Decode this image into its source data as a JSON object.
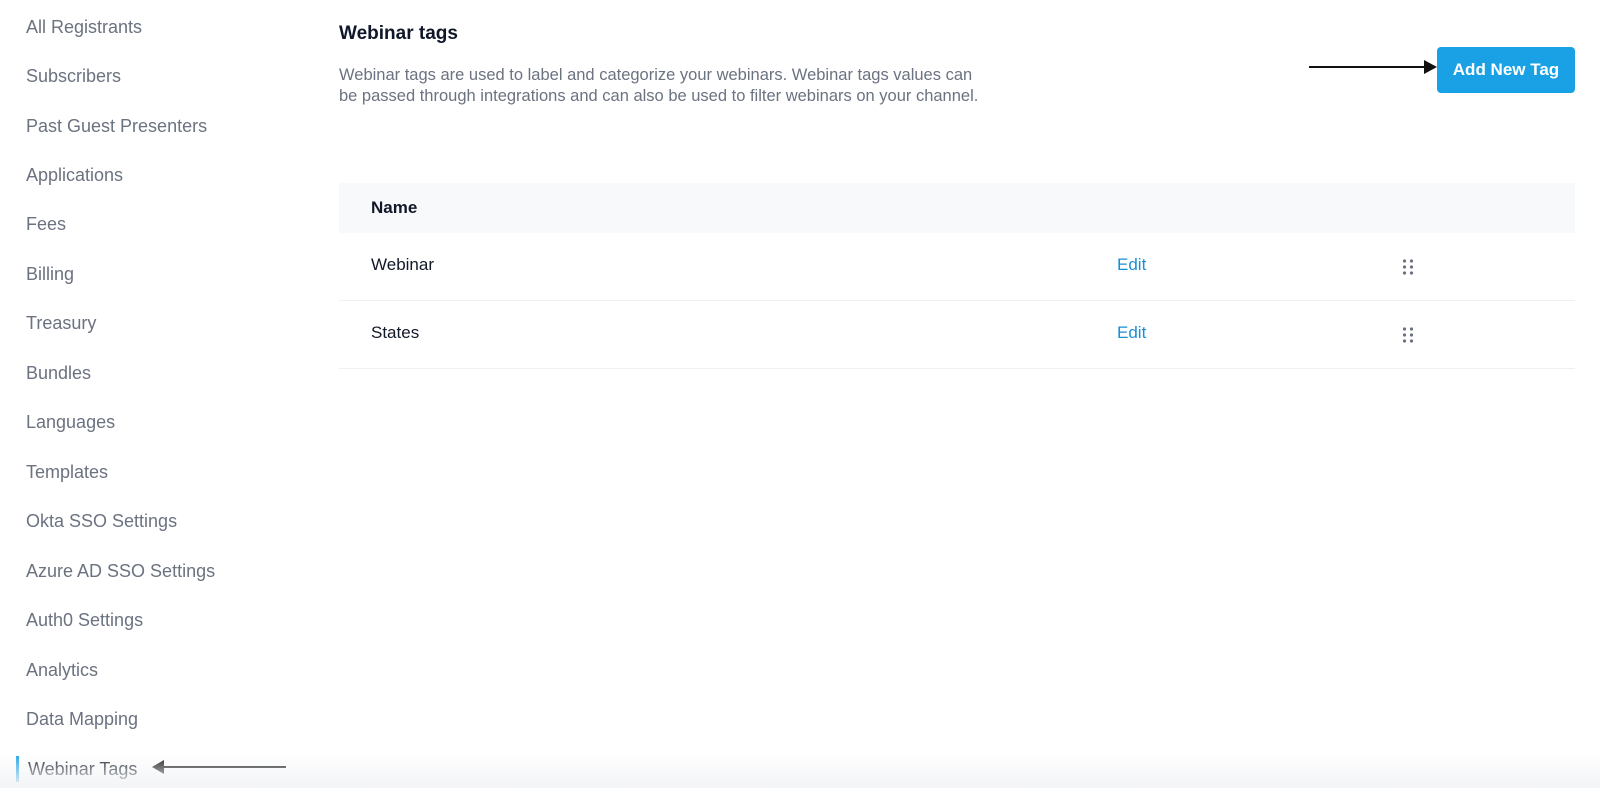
{
  "sidebar": {
    "items": [
      {
        "label": "All Registrants"
      },
      {
        "label": "Subscribers"
      },
      {
        "label": "Past Guest Presenters"
      },
      {
        "label": "Applications"
      },
      {
        "label": "Fees"
      },
      {
        "label": "Billing"
      },
      {
        "label": "Treasury"
      },
      {
        "label": "Bundles"
      },
      {
        "label": "Languages"
      },
      {
        "label": "Templates"
      },
      {
        "label": "Okta SSO Settings"
      },
      {
        "label": "Azure AD SSO Settings"
      },
      {
        "label": "Auth0 Settings"
      },
      {
        "label": "Analytics"
      },
      {
        "label": "Data Mapping"
      },
      {
        "label": "Webinar Tags",
        "active": true
      }
    ]
  },
  "header": {
    "title": "Webinar tags",
    "description": "Webinar tags are used to label and categorize your webinars. Webinar tags values can be passed through integrations and can also be used to filter webinars on your channel.",
    "add_button_label": "Add New Tag"
  },
  "table": {
    "columns": [
      "Name"
    ],
    "rows": [
      {
        "name": "Webinar",
        "action": "Edit"
      },
      {
        "name": "States",
        "action": "Edit"
      }
    ]
  },
  "icons": {
    "drag_handle": "drag-handle-icon",
    "arrow": "arrow-icon"
  },
  "colors": {
    "accent": "#1aa1e5",
    "link": "#1a8fd6"
  }
}
